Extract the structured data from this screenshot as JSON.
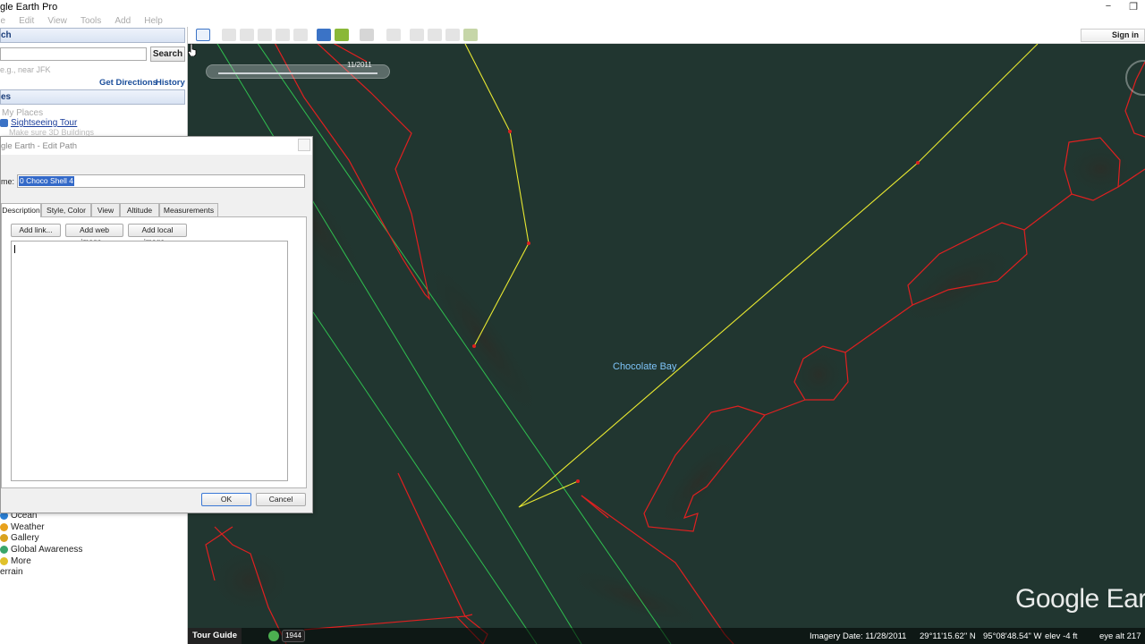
{
  "window": {
    "title": "gle Earth Pro",
    "minimize": "−",
    "restore": "❐"
  },
  "menu": [
    "ile",
    "Edit",
    "View",
    "Tools",
    "Add",
    "Help"
  ],
  "search_panel": {
    "header": "ch",
    "search_button": "Search",
    "hint": "e.g., near JFK",
    "get_directions": "Get Directions",
    "history": "History"
  },
  "places_panel": {
    "header": "es",
    "items": [
      {
        "label": "My Places",
        "style": "faded"
      },
      {
        "label": "Sightseeing Tour",
        "style": "link"
      },
      {
        "label": "Make sure 3D Buildings",
        "style": "faded"
      }
    ]
  },
  "layers": {
    "items": [
      "Ocean",
      "Weather",
      "Gallery",
      "Global Awareness",
      "More",
      "errain"
    ]
  },
  "dialog": {
    "title": "gle Earth - Edit Path",
    "name_label": "me:",
    "name_value": "0 Choco Shell 4",
    "tabs": [
      "Description",
      "Style, Color",
      "View",
      "Altitude",
      "Measurements"
    ],
    "active_tab": "Description",
    "add_link": "Add link...",
    "add_web_image": "Add web image...",
    "add_local_image": "Add local image...",
    "ok": "OK",
    "cancel": "Cancel"
  },
  "toolbar": {
    "sign_in": "Sign in"
  },
  "map": {
    "slider_date": "11/2011",
    "place_label": "Chocolate Bay",
    "watermark": "Google Ear",
    "colors": {
      "water": "#20352f",
      "polygon": "#e02020",
      "path": "#e8e830",
      "guide": "#2fbf4f"
    }
  },
  "status": {
    "tour_guide": "Tour Guide",
    "year": "1944",
    "imagery_date": "Imagery Date: 11/28/2011",
    "lat": "29°11'15.62\" N",
    "lon": "95°08'48.54\" W",
    "elev": "elev    -4 ft",
    "eye_alt": "eye alt  217"
  }
}
